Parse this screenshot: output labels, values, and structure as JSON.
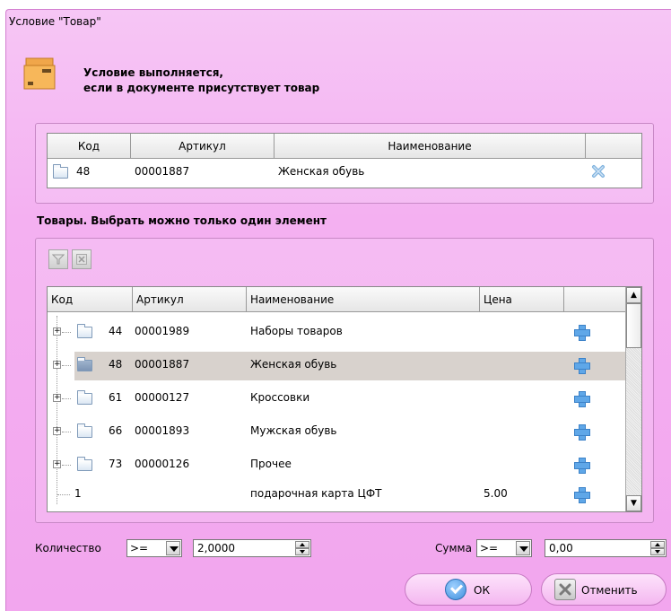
{
  "window": {
    "title": "Условие \"Товар\""
  },
  "condition": {
    "line1": "Условие выполняется,",
    "line2": "если в документе присутствует товар"
  },
  "selected_table": {
    "headers": [
      "Код",
      "Артикул",
      "Наименование",
      ""
    ],
    "rows": [
      {
        "code": "48",
        "article": "00001887",
        "name": "Женская обувь"
      }
    ]
  },
  "products": {
    "label": "Товары. Выбрать можно только один элемент",
    "headers": [
      "Код",
      "Артикул",
      "Наименование",
      "Цена",
      ""
    ],
    "rows": [
      {
        "code": "44",
        "article": "00001989",
        "name": "Наборы товаров",
        "price": ""
      },
      {
        "code": "48",
        "article": "00001887",
        "name": "Женская обувь",
        "price": ""
      },
      {
        "code": "61",
        "article": "00000127",
        "name": "Кроссовки",
        "price": ""
      },
      {
        "code": "66",
        "article": "00001893",
        "name": "Мужская обувь",
        "price": ""
      },
      {
        "code": "73",
        "article": "00000126",
        "name": "Прочее",
        "price": ""
      },
      {
        "code": "1",
        "article": "",
        "name": "подарочная карта ЦФТ",
        "price": "5.00"
      }
    ]
  },
  "quantity": {
    "label": "Количество",
    "operator": ">=",
    "value": "2,0000"
  },
  "sum": {
    "label": "Сумма",
    "operator": ">=",
    "value": "0,00"
  },
  "buttons": {
    "ok": "ОК",
    "cancel": "Отменить"
  },
  "colors": {
    "background": "#f4b0f1",
    "selection": "#d8d2cd",
    "accent": "#5fa7e8"
  },
  "icons": [
    "box-icon",
    "folder-icon",
    "remove-icon",
    "add-icon",
    "filter-icon",
    "clear-filter-icon",
    "ok-icon",
    "cancel-icon"
  ]
}
